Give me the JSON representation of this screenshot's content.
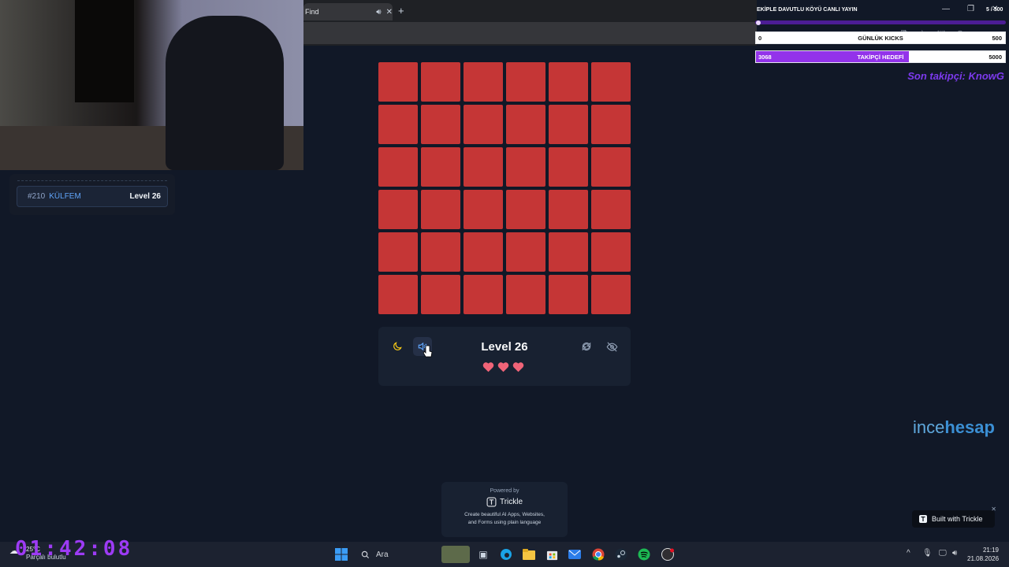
{
  "browser": {
    "tab_title": "Find",
    "tab_audio_icon": "speaker-icon",
    "new_tab": "+",
    "tab_close": "✕"
  },
  "leaderboard": {
    "rank": "#210",
    "name": "KÜLFEM",
    "level": "Level 26"
  },
  "game": {
    "grid_rows": 6,
    "grid_cols": 6,
    "tile_color": "#c53636",
    "level_label": "Level 26",
    "lives": 3,
    "heart_color": "#f06478",
    "theme_icon": "moon-icon",
    "sound_icon": "speaker-icon",
    "restart_icon": "restart-icon",
    "hide_icon": "eye-off-icon"
  },
  "powered": {
    "label": "Powered by",
    "brand": "Trickle",
    "desc_line1": "Create beautiful AI Apps, Websites,",
    "desc_line2": "and Forms using plain language"
  },
  "stream": {
    "title": "EKİPLE DAVUTLU KÖYÜ CANLI YAYIN",
    "viewers": "5 / 300",
    "goals": [
      {
        "current": "0",
        "name": "GÜNLÜK KICKS",
        "target": "500",
        "progress": 0.0,
        "color": "#ffffff"
      },
      {
        "current": "3068",
        "name": "TAKİPÇİ HEDEFİ",
        "target": "5000",
        "progress": 0.6136,
        "color": "#9333ea"
      }
    ],
    "last_follower": "Son takipçi: KnowG"
  },
  "brand_watermark": {
    "part1": "ince",
    "part2": "hesap"
  },
  "built_badge": {
    "label": "Built with Trickle",
    "close": "✕"
  },
  "taskbar": {
    "temp": "25°C",
    "weather": "Parçalı bulutlu",
    "timer": "01:42:08",
    "search_placeholder": "Ara",
    "time": "21:19",
    "date": "21.08.2026"
  },
  "colors": {
    "background": "#111827",
    "accent_purple": "#9333ea",
    "timer_purple": "#9d3bf5"
  }
}
